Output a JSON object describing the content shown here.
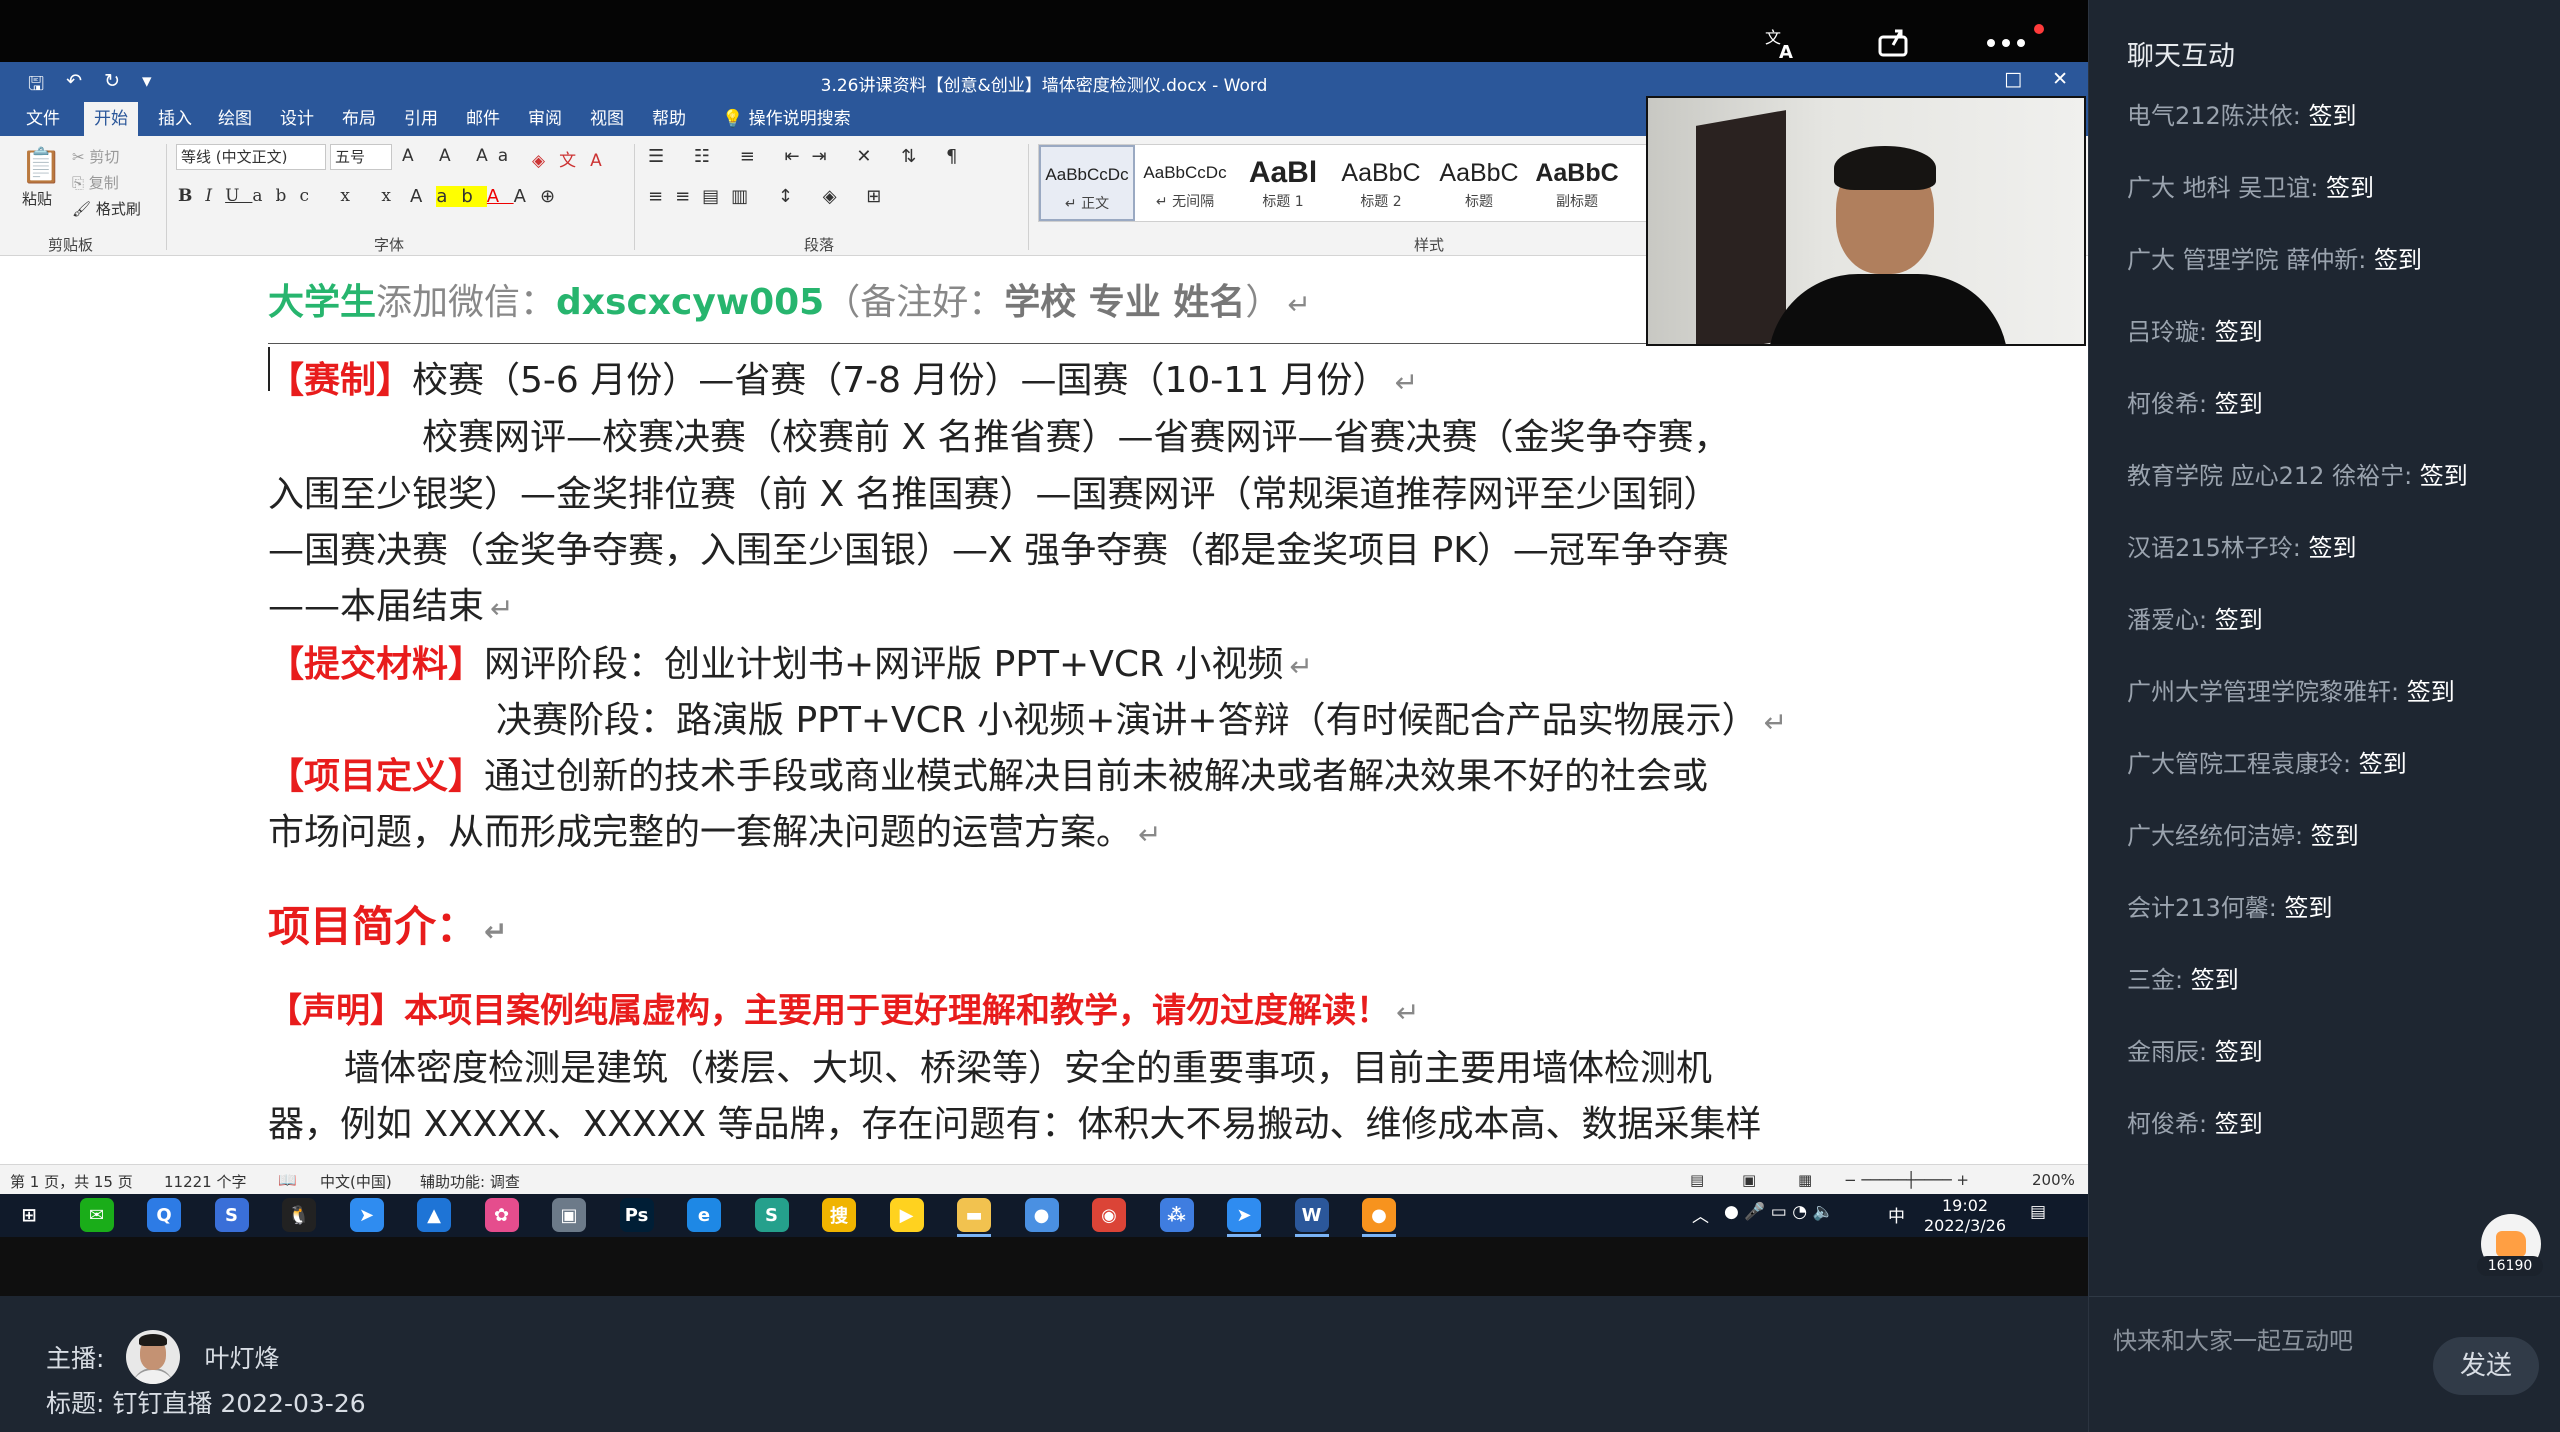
{
  "stream_controls": {
    "translate_icon": "translate-icon",
    "popout_icon": "popout-icon",
    "more_icon": "more-icon"
  },
  "word": {
    "quick_access": [
      "🖫",
      "↶",
      "↻",
      "▾"
    ],
    "title": "3.26讲课资料【创意&创业】墙体密度检测仪.docx  -  Word",
    "tabs": [
      "文件",
      "开始",
      "插入",
      "绘图",
      "设计",
      "布局",
      "引用",
      "邮件",
      "审阅",
      "视图",
      "帮助"
    ],
    "active_tab": "开始",
    "tell_me": "操作说明搜索",
    "ribbon": {
      "paste_label": "粘贴",
      "cut": "剪切",
      "copy": "复制",
      "format_painter": "格式刷",
      "clipboard_group": "剪贴板",
      "font_name": "等线 (中文正文)",
      "font_size": "五号",
      "font_group": "字体",
      "paragraph_group": "段落",
      "styles_group": "样式",
      "styles": [
        {
          "sample": "AaBbCcDc",
          "name": "↵ 正文"
        },
        {
          "sample": "AaBbCcDc",
          "name": "↵ 无间隔"
        },
        {
          "sample": "AaBl",
          "name": "标题 1"
        },
        {
          "sample": "AaBbC",
          "name": "标题 2"
        },
        {
          "sample": "AaBbC",
          "name": "标题"
        },
        {
          "sample": "AaBbC",
          "name": "副标题"
        }
      ]
    },
    "doc": {
      "header_green": "大学生",
      "header_text1": "添加微信：",
      "header_wechat": "dxscxcyw005",
      "header_text2": "（备注好：",
      "header_bold": "学校  专业  姓名",
      "header_text3": "）",
      "l1_red": "【赛制】",
      "l1_text": "校赛（5-6 月份）—省赛（7-8 月份）—国赛（10-11 月份）",
      "l2_text": "校赛网评—校赛决赛（校赛前 X 名推省赛）—省赛网评—省赛决赛（金奖争夺赛，",
      "l3_text": "入围至少银奖）—金奖排位赛（前 X 名推国赛）—国赛网评（常规渠道推荐网评至少国铜）",
      "l4_text": "—国赛决赛（金奖争夺赛，入围至少国银）—X 强争夺赛（都是金奖项目 PK）—冠军争夺赛",
      "l5_text": "——本届结束",
      "l6_red": "【提交材料】",
      "l6_text": "网评阶段：创业计划书+网评版 PPT+VCR 小视频",
      "l7_text": "决赛阶段：路演版 PPT+VCR 小视频+演讲+答辩（有时候配合产品实物展示）",
      "l8_red": "【项目定义】",
      "l8_text": "通过创新的技术手段或商业模式解决目前未被解决或者解决效果不好的社会或",
      "l9_text": "市场问题，从而形成完整的一套解决问题的运营方案。",
      "section_title": "项目简介：",
      "l10_red": "【声明】本项目案例纯属虚构，主要用于更好理解和教学，请勿过度解读！",
      "l11_text": "墙体密度检测是建筑（楼层、大坝、桥梁等）安全的重要事项，目前主要用墙体检测机",
      "l12_text": "器，例如 XXXXX、XXXXX 等品牌，存在问题有：体积大不易搬动、维修成本高、数据采集样",
      "return_mark": "↵"
    },
    "status": {
      "page": "第 1 页，共 15 页",
      "words": "11221 个字",
      "lang": "中文(中国)",
      "accessibility": "辅助功能: 调查",
      "zoom": "200%"
    }
  },
  "taskbar": {
    "icons": [
      {
        "name": "windows-start-icon",
        "glyph": "⊞",
        "color": "#101a2a"
      },
      {
        "name": "wechat-icon",
        "glyph": "✉",
        "color": "#1aad19"
      },
      {
        "name": "search-app-icon",
        "glyph": "Q",
        "color": "#2d7be5"
      },
      {
        "name": "sogou-icon",
        "glyph": "S",
        "color": "#3a6fd8"
      },
      {
        "name": "qq-icon",
        "glyph": "🐧",
        "color": "#222222"
      },
      {
        "name": "dingtalk-icon",
        "glyph": "➤",
        "color": "#2f8cf0"
      },
      {
        "name": "photos-icon",
        "glyph": "▲",
        "color": "#1e74d6"
      },
      {
        "name": "app-icon",
        "glyph": "✿",
        "color": "#e54d8d"
      },
      {
        "name": "tools-icon",
        "glyph": "▣",
        "color": "#6c7a89"
      },
      {
        "name": "photoshop-icon",
        "glyph": "Ps",
        "color": "#001e36"
      },
      {
        "name": "browser-icon",
        "glyph": "e",
        "color": "#1e88e5"
      },
      {
        "name": "wps-icon",
        "glyph": "S",
        "color": "#25a08c"
      },
      {
        "name": "sogou-input-icon",
        "glyph": "搜",
        "color": "#f0b400"
      },
      {
        "name": "player-icon",
        "glyph": "▶",
        "color": "#ffd21f"
      },
      {
        "name": "folder-icon",
        "glyph": "▬",
        "color": "#f2c24f"
      },
      {
        "name": "meeting-icon",
        "glyph": "●",
        "color": "#4a90e2"
      },
      {
        "name": "chrome-icon",
        "glyph": "◉",
        "color": "#db4437"
      },
      {
        "name": "network-icon",
        "glyph": "⁂",
        "color": "#3f7de0"
      },
      {
        "name": "dingtalk2-icon",
        "glyph": "➤",
        "color": "#2f8cf0"
      },
      {
        "name": "word-icon",
        "glyph": "W",
        "color": "#2b579a"
      },
      {
        "name": "live-icon",
        "glyph": "●",
        "color": "#f7931e"
      }
    ],
    "tray": {
      "ime": "中",
      "time": "19:02",
      "date": "2022/3/26"
    }
  },
  "broadcast": {
    "host_label": "主播:",
    "host_name": "叶灯烽",
    "title_label": "标题:",
    "title_value": "钉钉直播 2022-03-26"
  },
  "chat": {
    "title": "聊天互动",
    "messages": [
      {
        "user": "电气212陈洪依:",
        "text": "签到"
      },
      {
        "user": "广大 地科 吴卫谊:",
        "text": "签到"
      },
      {
        "user": "广大 管理学院 薛仲新:",
        "text": "签到"
      },
      {
        "user": "吕玲璇:",
        "text": "签到"
      },
      {
        "user": "柯俊希:",
        "text": "签到"
      },
      {
        "user": "教育学院 应心212 徐裕宁:",
        "text": "签到"
      },
      {
        "user": "汉语215林子玲:",
        "text": "签到"
      },
      {
        "user": "潘爱心:",
        "text": "签到"
      },
      {
        "user": "广州大学管理学院黎雅轩:",
        "text": "签到"
      },
      {
        "user": "广大管院工程袁康玲:",
        "text": "签到"
      },
      {
        "user": "广大经统何洁婷:",
        "text": "签到"
      },
      {
        "user": "会计213何馨:",
        "text": "签到"
      },
      {
        "user": "三金:",
        "text": "签到"
      },
      {
        "user": "金雨辰:",
        "text": "签到"
      },
      {
        "user": "柯俊希:",
        "text": "签到"
      }
    ],
    "like_count": "16190",
    "input_placeholder": "快来和大家一起互动吧",
    "send_label": "发送"
  }
}
